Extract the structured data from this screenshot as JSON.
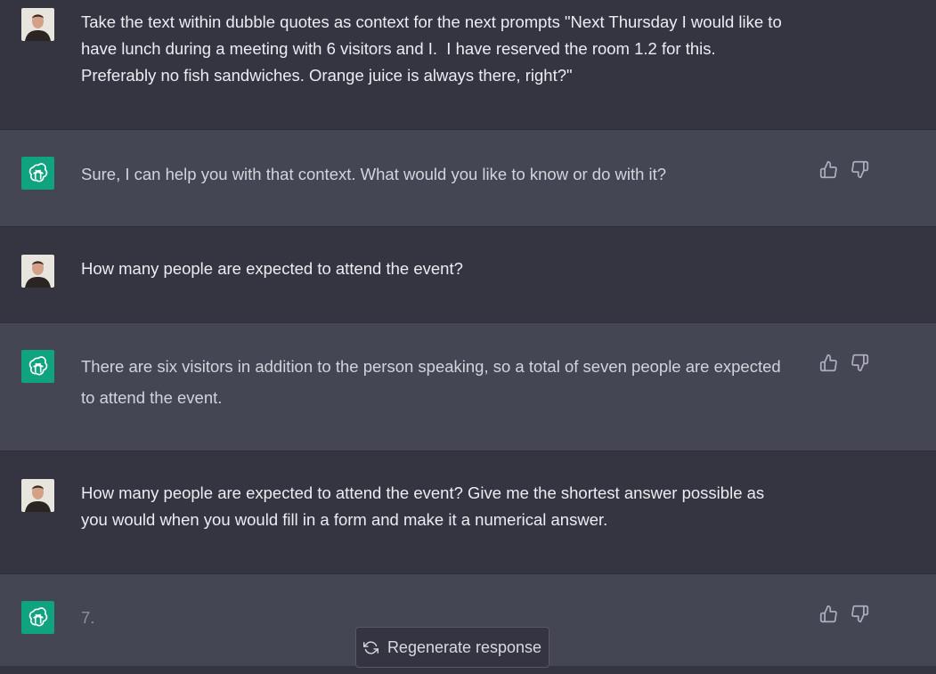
{
  "conversation": [
    {
      "role": "user",
      "text": "Take the text within dubble quotes as context for the next prompts \"Next Thursday I would like to have lunch during a meeting with 6 visitors and I.  I have reserved the room 1.2 for this. Preferably no fish sandwiches. Orange juice is always there, right?\""
    },
    {
      "role": "assistant",
      "text": "Sure, I can help you with that context. What would you like to know or do with it?"
    },
    {
      "role": "user",
      "text": "How many people are expected to attend the event?"
    },
    {
      "role": "assistant",
      "text": "There are six visitors in addition to the person speaking, so a total of seven people are expected to attend the event."
    },
    {
      "role": "user",
      "text": "How many people are expected to attend the event? Give me the shortest answer possible as you would when you would fill in a form and make it a numerical answer."
    },
    {
      "role": "assistant",
      "text": "7."
    }
  ],
  "regenerate_button": {
    "label": "Regenerate response"
  },
  "colors": {
    "user_bg": "#343541",
    "assistant_bg": "#444654",
    "gpt_avatar": "#10a37f"
  },
  "icons": {
    "user_avatar": "user-avatar-photo",
    "assistant_avatar": "openai-logo-icon",
    "feedback_up": "thumbs-up-icon",
    "feedback_down": "thumbs-down-icon",
    "regenerate": "refresh-icon"
  }
}
